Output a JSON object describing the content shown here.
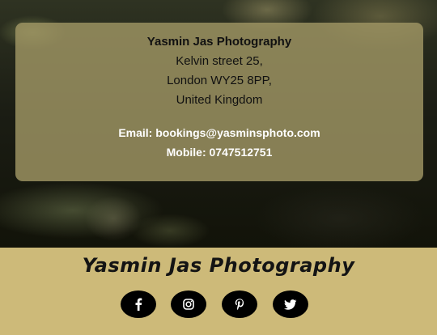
{
  "contact": {
    "company": "Yasmin Jas Photography",
    "street": "Kelvin street 25,",
    "city": "London WY25 8PP,",
    "country": "United Kingdom",
    "email": "Email: bookings@yasminsphoto.com",
    "mobile": "Mobile: 0747512751"
  },
  "footer": {
    "brand": "Yasmin Jas Photography",
    "social": [
      {
        "icon": "facebook-icon"
      },
      {
        "icon": "instagram-icon"
      },
      {
        "icon": "pinterest-icon"
      },
      {
        "icon": "twitter-icon"
      }
    ]
  },
  "colors": {
    "footer_bg": "#cdba79",
    "card_bg": "#a0966499",
    "social_bg": "#000000"
  }
}
